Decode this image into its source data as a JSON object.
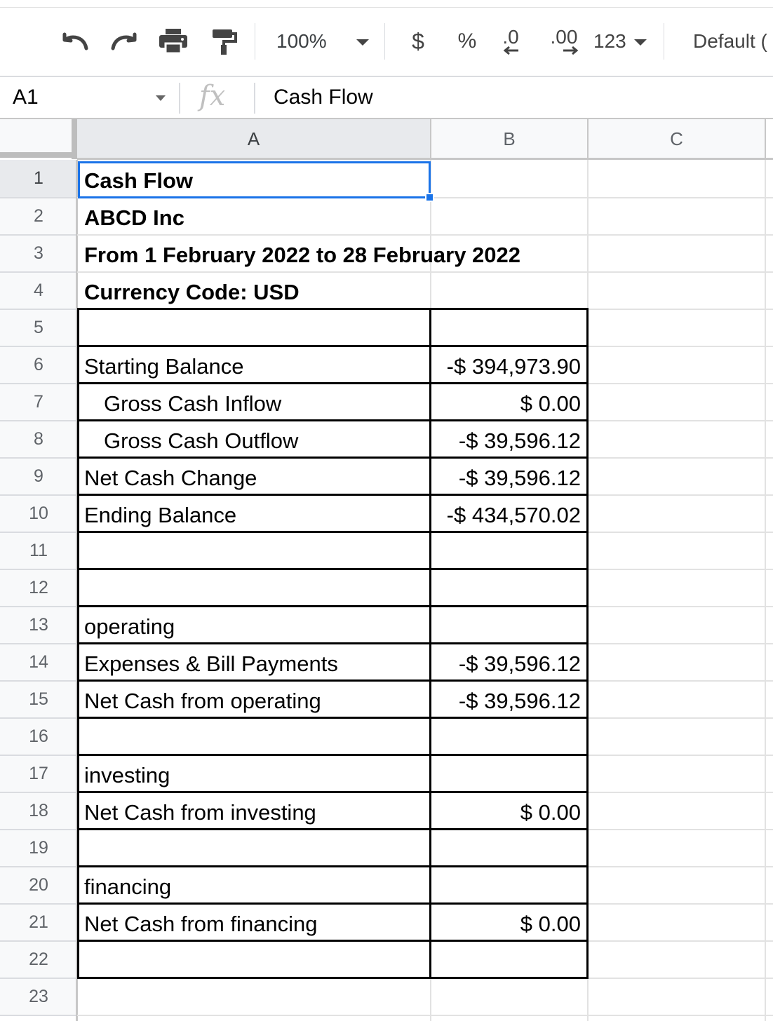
{
  "toolbar": {
    "zoom": "100%",
    "currency_label": "$",
    "percent_label": "%",
    "decrease_decimal_label": ".0",
    "increase_decimal_label": ".00",
    "number_format_label": "123",
    "font_label": "Default ("
  },
  "formula_bar": {
    "cell_ref": "A1",
    "fx_label": "fx",
    "content": "Cash Flow"
  },
  "columns": [
    "A",
    "B",
    "C"
  ],
  "rows": [
    "1",
    "2",
    "3",
    "4",
    "5",
    "6",
    "7",
    "8",
    "9",
    "10",
    "11",
    "12",
    "13",
    "14",
    "15",
    "16",
    "17",
    "18",
    "19",
    "20",
    "21",
    "22",
    "23"
  ],
  "sheet": {
    "title": "Cash Flow",
    "company": "ABCD Inc",
    "period": "From 1 February 2022  to 28 February 2022",
    "currency": "Currency Code: USD",
    "starting_balance_label": "Starting Balance",
    "starting_balance_value": "-$ 394,973.90",
    "gross_inflow_label": "Gross Cash Inflow",
    "gross_inflow_value": "$ 0.00",
    "gross_outflow_label": "Gross Cash Outflow",
    "gross_outflow_value": "-$ 39,596.12",
    "net_change_label": "Net Cash Change",
    "net_change_value": "-$ 39,596.12",
    "ending_balance_label": "Ending Balance",
    "ending_balance_value": "-$ 434,570.02",
    "operating_label": "operating",
    "expenses_label": "Expenses & Bill Payments",
    "expenses_value": "-$ 39,596.12",
    "net_operating_label": "Net Cash from operating",
    "net_operating_value": "-$ 39,596.12",
    "investing_label": "investing",
    "net_investing_label": "Net Cash from investing",
    "net_investing_value": "$ 0.00",
    "financing_label": "financing",
    "net_financing_label": "Net Cash from financing",
    "net_financing_value": "$ 0.00"
  },
  "colors": {
    "selection": "#1a73e8",
    "header_bg": "#f8f9fa",
    "selected_header_bg": "#e8eaed",
    "gridline": "#e2e2e2"
  }
}
